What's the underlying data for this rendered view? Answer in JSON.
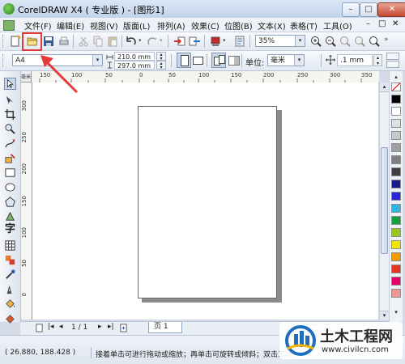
{
  "window": {
    "title": "CorelDRAW X4 ( 专业版 ) - [图形1]",
    "minimize": "–",
    "maximize": "□",
    "close": "✕"
  },
  "menu": {
    "items": [
      "文件(F)",
      "编辑(E)",
      "视图(V)",
      "版面(L)",
      "排列(A)",
      "效果(C)",
      "位图(B)",
      "文本(X)",
      "表格(T)",
      "工具(O)"
    ],
    "doc_controls": [
      "–",
      "□",
      "✕"
    ]
  },
  "toolbar": {
    "zoom_value": "35%"
  },
  "property_bar": {
    "paper_size": "A4",
    "width": "210.0 mm",
    "height": "297.0 mm",
    "units_label": "单位:",
    "units_value": "毫米",
    "nudge_value": ".1 mm"
  },
  "rulers": {
    "top_ticks": [
      "150",
      "100",
      "50",
      "0",
      "50",
      "100",
      "150",
      "200",
      "250",
      "300",
      "350"
    ],
    "left_ticks": [
      "300",
      "250",
      "200",
      "150",
      "100",
      "50",
      "0"
    ],
    "unit": "毫米"
  },
  "pagebar": {
    "page_count": "1 / 1",
    "page_tab": "页 1"
  },
  "status": {
    "coordinates": "( 26.880, 188.428 )",
    "hint": "接着单击可进行拖动或缩放；再单击可旋转或倾斜；双击工具..."
  },
  "palette_colors": [
    "#ffffff",
    "#000000",
    "#ffffff",
    "#e0e0e0",
    "#c8c8c8",
    "#a0a0a0",
    "#808080",
    "#404040",
    "#1a1a8c",
    "#2828d8",
    "#2eb5e8",
    "#14a03c",
    "#96c81e",
    "#f0e600",
    "#f59b00",
    "#e8361e",
    "#e6006e",
    "#f09696"
  ],
  "colors": {
    "highlight": "#e53935"
  },
  "watermark": {
    "brand": "土木工程网",
    "url": "www.civilcn.com"
  }
}
